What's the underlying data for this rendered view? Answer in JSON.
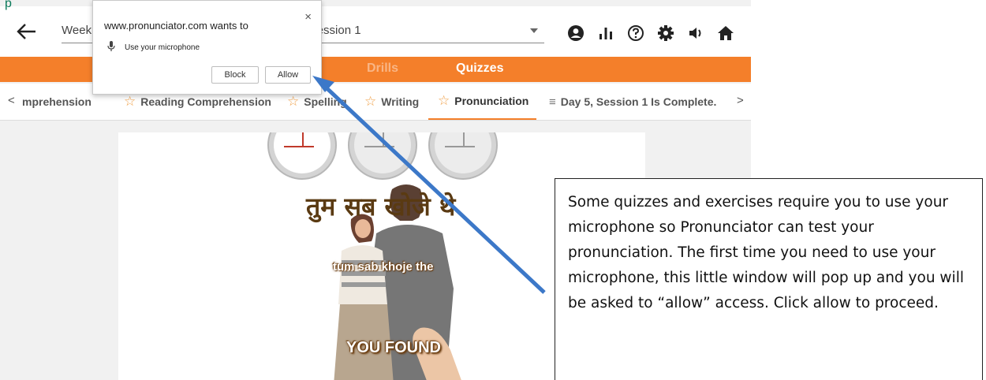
{
  "top_bar": {
    "week_label": "Week",
    "session_label": "ay 5 - Session 1"
  },
  "mode_tabs": [
    {
      "label": "Drills",
      "active": false
    },
    {
      "label": "Quizzes",
      "active": true
    }
  ],
  "quiz_tabs": {
    "items": [
      {
        "label": "mprehension",
        "icon": "star-icon"
      },
      {
        "label": "Reading Comprehension",
        "icon": "star-icon"
      },
      {
        "label": "Spelling",
        "icon": "star-icon"
      },
      {
        "label": "Writing",
        "icon": "star-icon"
      },
      {
        "label": "Pronunciation",
        "icon": "star-icon",
        "active": true
      },
      {
        "label": "Day 5, Session 1 Is Complete.",
        "icon": "list-icon"
      }
    ]
  },
  "lesson": {
    "hindi_text": "तुम सब खोजे थे",
    "transliteration": "tum sab khoje the",
    "caption": "YOU FOUND"
  },
  "permission_popup": {
    "site_text": "www.pronunciator.com wants to",
    "permission_text": "Use your microphone",
    "close_symbol": "×",
    "block_label": "Block",
    "allow_label": "Allow"
  },
  "annotation": {
    "callout_text": "Some quizzes and exercises require you to use your microphone so Pronunciator can test your pronunciation. The first time you need to use your microphone, this little window will pop up and you will be asked to “allow” access. Click allow to proceed."
  },
  "colors": {
    "accent_orange": "#f47f2a",
    "star_color": "#f0a14a",
    "arrow_blue": "#3c78c8"
  }
}
